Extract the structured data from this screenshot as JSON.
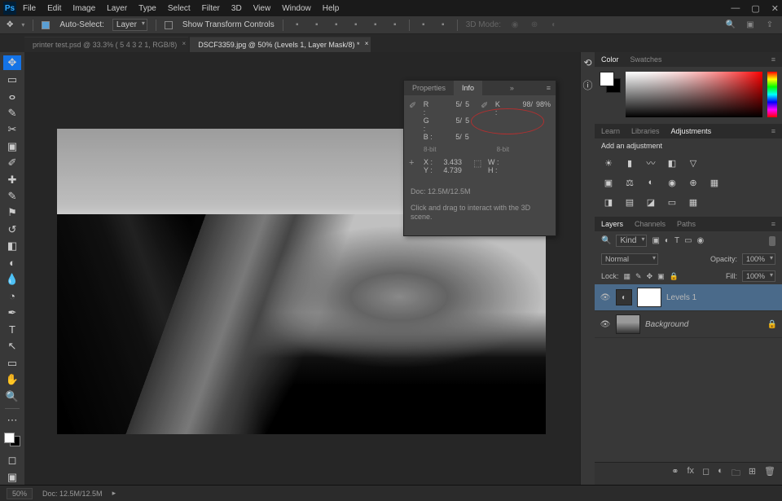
{
  "menubar": [
    "File",
    "Edit",
    "Image",
    "Layer",
    "Type",
    "Select",
    "Filter",
    "3D",
    "View",
    "Window",
    "Help"
  ],
  "options": {
    "auto_select": "Auto-Select:",
    "layer": "Layer",
    "show_transform": "Show Transform Controls",
    "mode": "3D Mode:"
  },
  "tabs": [
    {
      "label": "printer test.psd @ 33.3% (  5       4       3       2       1, RGB/8)",
      "active": false
    },
    {
      "label": "DSCF3359.jpg @ 50% (Levels 1, Layer Mask/8) *",
      "active": true
    }
  ],
  "info": {
    "tab1": "Properties",
    "tab2": "Info",
    "r": "R :",
    "g": "G :",
    "b": "B :",
    "r_vals": [
      "5/",
      "5"
    ],
    "g_vals": [
      "5/",
      "5"
    ],
    "b_vals": [
      "5/",
      "5"
    ],
    "k": "K :",
    "k_vals": [
      "98/",
      "98%"
    ],
    "bit1": "8-bit",
    "bit2": "8-bit",
    "x": "X :",
    "y": "Y :",
    "x_val": "3.433",
    "y_val": "4.739",
    "w": "W :",
    "h": "H :",
    "doc": "Doc: 12.5M/12.5M",
    "hint": "Click and drag to interact with the 3D scene."
  },
  "right": {
    "color_tab": "Color",
    "swatches_tab": "Swatches",
    "learn": "Learn",
    "libraries": "Libraries",
    "adjustments": "Adjustments",
    "add_adj": "Add an adjustment",
    "layers": "Layers",
    "channels": "Channels",
    "paths": "Paths",
    "kind": "Kind",
    "normal": "Normal",
    "opacity_lbl": "Opacity:",
    "opacity_val": "100%",
    "lock": "Lock:",
    "fill_lbl": "Fill:",
    "fill_val": "100%",
    "layer1": "Levels 1",
    "layer2": "Background"
  },
  "status": {
    "zoom": "50%",
    "doc": "Doc: 12.5M/12.5M"
  }
}
